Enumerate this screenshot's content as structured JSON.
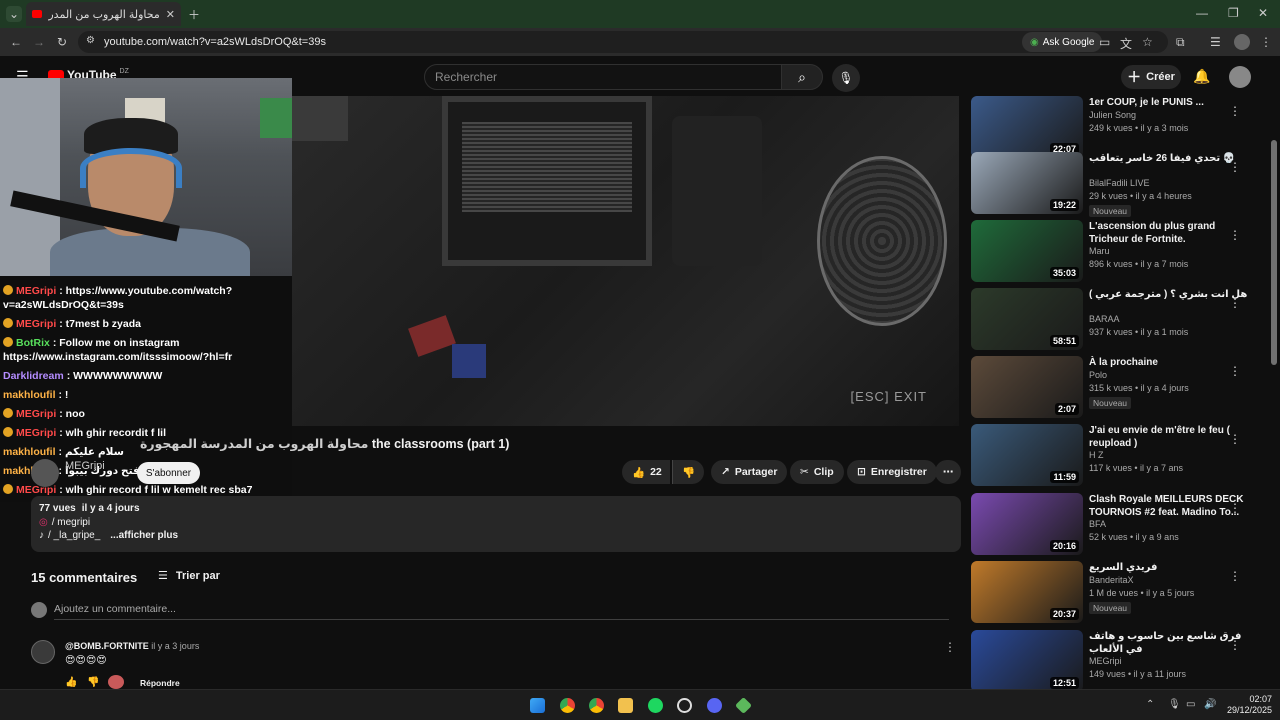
{
  "browser": {
    "tab_title": "محاولة الهروب من المدرسة المهج...",
    "url": "youtube.com/watch?v=a2sWLdsDrOQ&t=39s",
    "ask_google": "Ask Google"
  },
  "youtube": {
    "logo_text": "YouTube",
    "country": "DZ",
    "search_placeholder": "Rechercher",
    "create_label": "Créer"
  },
  "video": {
    "overlay_exit": "[ESC]  EXIT",
    "title": "the classrooms (part 1)",
    "title_arabic": "محاولة الهروب من المدرسة المهجورة",
    "channel": "MEGripi",
    "subscribe": "S'abonner",
    "likes": "22",
    "share": "Partager",
    "clip": "Clip",
    "save": "Enregistrer",
    "views": "77 vues",
    "age": "il y a 4 jours",
    "desc_line1": "/ megripi",
    "desc_line2": "/ _la_gripe_",
    "show_more": "...afficher plus"
  },
  "chat": [
    {
      "user": "MEGripi",
      "color": "red",
      "text": ": https://www.youtube.com/watch?v=a2sWLdsDrOQ&t=39s"
    },
    {
      "user": "MEGripi",
      "color": "red",
      "text": ": t7mest b zyada"
    },
    {
      "user": "BotRix",
      "color": "green",
      "text": ": Follow me on instagram https://www.instagram.com/itsssimoow/?hl=fr"
    },
    {
      "user": "Darklidream",
      "color": "purple",
      "text": ": WWWWWWWWW"
    },
    {
      "user": "makhloufil",
      "color": "orange",
      "text": ": !"
    },
    {
      "user": "MEGripi",
      "color": "red",
      "text": ": noo"
    },
    {
      "user": "MEGripi",
      "color": "red",
      "text": ": wlh ghir recordit f lil"
    },
    {
      "user": "makhloufil",
      "color": "orange",
      "text": ": سلام عليكم"
    },
    {
      "user": "makhloufil",
      "color": "orange",
      "text": ": افتح دورك بيبوا"
    },
    {
      "user": "MEGripi",
      "color": "red",
      "text": ": wlh ghir record f lil w kemelt rec sba7"
    }
  ],
  "comments": {
    "count_label": "15 commentaires",
    "sort_label": "Trier par",
    "add_placeholder": "Ajoutez un commentaire...",
    "first": {
      "author": "@BOMB.FORTNITE",
      "age": "il y a 3 jours",
      "text": "😍😍😍😍",
      "reply": "Répondre"
    }
  },
  "sidebar": [
    {
      "title": "1er COUP, je le PUNIS ...",
      "channel": "Julien Song",
      "meta": "249 k vues • il y a 3 mois",
      "duration": "22:07",
      "new": "",
      "color": "#3b5a8a"
    },
    {
      "title": "تحدي فيفا 26 خاسر يتعاقب 💀",
      "channel": "BilalFadili LIVE",
      "meta": "29 k vues • il y a 4 heures",
      "duration": "19:22",
      "new": "Nouveau",
      "color": "#9aa8b8"
    },
    {
      "title": "L'ascension du plus grand Tricheur de Fortnite.",
      "channel": "Maru",
      "meta": "896 k vues • il y a 7 mois",
      "duration": "35:03",
      "new": "",
      "color": "#1f6b3a"
    },
    {
      "title": "هل انت بشري ؟ ( مترجمة عربي )",
      "channel": "BARAA",
      "meta": "937 k vues • il y a 1 mois",
      "duration": "58:51",
      "new": "",
      "color": "#2c3a2a"
    },
    {
      "title": "À la prochaine",
      "channel": "Polo",
      "meta": "315 k vues • il y a 4 jours",
      "duration": "2:07",
      "new": "Nouveau",
      "color": "#5c4a3a"
    },
    {
      "title": "J'ai eu envie de m'être le feu ( reupload )",
      "channel": "H Z",
      "meta": "117 k vues • il y a 7 ans",
      "duration": "11:59",
      "new": "",
      "color": "#3a5a7a"
    },
    {
      "title": "Clash Royale MEILLEURS DECK TOURNOIS #2 feat. Madino To...",
      "channel": "BFA",
      "meta": "52 k vues • il y a 9 ans",
      "duration": "20:16",
      "new": "",
      "color": "#7a4ab0"
    },
    {
      "title": "فريدي السريع",
      "channel": "BanderitaX",
      "meta": "1 M de vues • il y a 5 jours",
      "duration": "20:37",
      "new": "Nouveau",
      "color": "#c07a2a"
    },
    {
      "title": "فرق شاسع بين حاسوب و هاتف في الألعاب",
      "channel": "MEGripi",
      "meta": "149 vues • il y a 11 jours",
      "duration": "12:51",
      "new": "",
      "color": "#2a4a9a"
    }
  ],
  "taskbar": {
    "time": "02:07",
    "date": "29/12/2025"
  }
}
